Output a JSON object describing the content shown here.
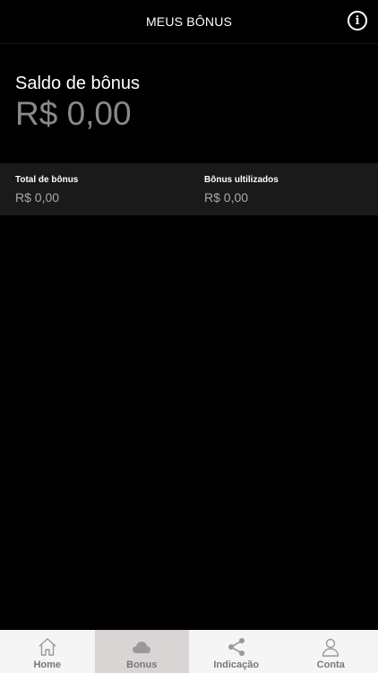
{
  "header": {
    "title": "MEUS BÔNUS",
    "info_icon": "info-icon"
  },
  "balance": {
    "label": "Saldo de bônus",
    "value": "R$ 0,00"
  },
  "summary": {
    "total_label": "Total de bônus",
    "total_value": "R$ 0,00",
    "used_label": "Bônus ultilizados",
    "used_value": "R$ 0,00"
  },
  "tabs": [
    {
      "label": "Home",
      "icon": "home-icon"
    },
    {
      "label": "Bonus",
      "icon": "cloud-icon",
      "active": true
    },
    {
      "label": "Indicação",
      "icon": "share-icon"
    },
    {
      "label": "Conta",
      "icon": "user-icon"
    }
  ],
  "colors": {
    "background": "#000000",
    "summary_bar": "#1a1a1a",
    "tabbar": "#f5f5f5",
    "active_tab": "#d9d5d5",
    "muted_text": "#8a8a8a"
  }
}
